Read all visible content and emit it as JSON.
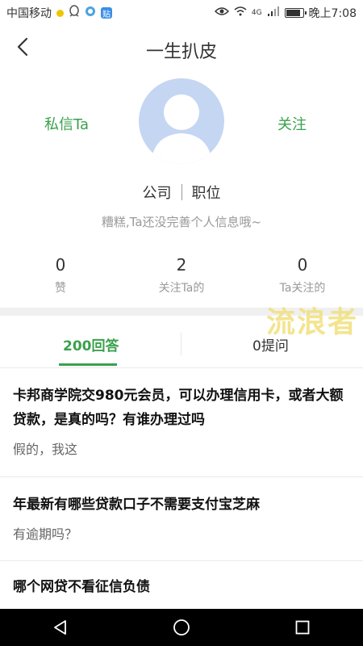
{
  "status_bar": {
    "carrier": "中国移动",
    "time": "晚上7:08",
    "network": "4G",
    "app_badge": "贴"
  },
  "header": {
    "title": "一生扒皮"
  },
  "profile": {
    "pm_label": "私信Ta",
    "follow_label": "关注",
    "company": "公司",
    "position": "职位",
    "bio": "糟糕,Ta还没完善个人信息哦~",
    "stats": [
      {
        "value": "0",
        "label": "赞"
      },
      {
        "value": "2",
        "label": "关注Ta的"
      },
      {
        "value": "0",
        "label": "Ta关注的"
      }
    ]
  },
  "watermark": "流浪者",
  "tabs": [
    {
      "label": "200回答",
      "active": true
    },
    {
      "label": "0提问",
      "active": false
    }
  ],
  "list": [
    {
      "title": "卡邦商学院交980元会员，可以办理信用卡，或者大额贷款，是真的吗？有谁办理过吗",
      "snippet": "假的，我这"
    },
    {
      "title": "年最新有哪些贷款口子不需要支付宝芝麻",
      "snippet": "有逾期吗？"
    },
    {
      "title": "哪个网贷不看征信负债",
      "snippet": ""
    }
  ],
  "colors": {
    "accent": "#3aa14c",
    "avatar_bg": "#c5d6f3",
    "watermark": "#f1e07c"
  },
  "icons": [
    "back-arrow-icon",
    "eye-icon",
    "wifi-icon",
    "signal-icon",
    "battery-icon",
    "nav-back-icon",
    "nav-home-icon",
    "nav-recents-icon"
  ]
}
